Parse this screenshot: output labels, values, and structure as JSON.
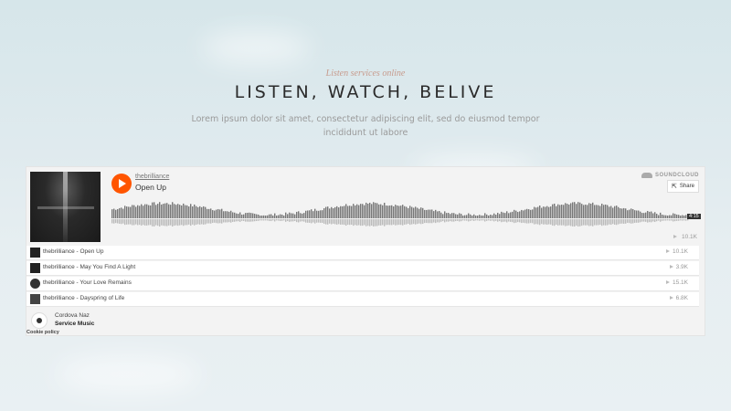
{
  "hero": {
    "subtitle": "Listen services online",
    "title": "LISTEN, WATCH, BELIVE",
    "lead": "Lorem ipsum dolor sit amet, consectetur adipiscing elit, sed do eiusmod tempor incididunt ut labore"
  },
  "player": {
    "artist": "thebrilliance",
    "track": "Open Up",
    "brand": "SOUNDCLOUD",
    "share_label": "Share",
    "duration": "4:15",
    "plays": "10.1K",
    "accent": "#ff5500"
  },
  "tracks": [
    {
      "name": "thebrilliance - Open Up",
      "plays": "10.1K"
    },
    {
      "name": "thebrilliance - May You Find A Light",
      "plays": "3.9K"
    },
    {
      "name": "thebrilliance - Your Love Remains",
      "plays": "15.1K"
    },
    {
      "name": "thebrilliance - Dayspring of Life",
      "plays": "6.8K"
    }
  ],
  "footer": {
    "user": "Cordova Naz",
    "label": "Service Music",
    "cookie": "Cookie policy"
  }
}
